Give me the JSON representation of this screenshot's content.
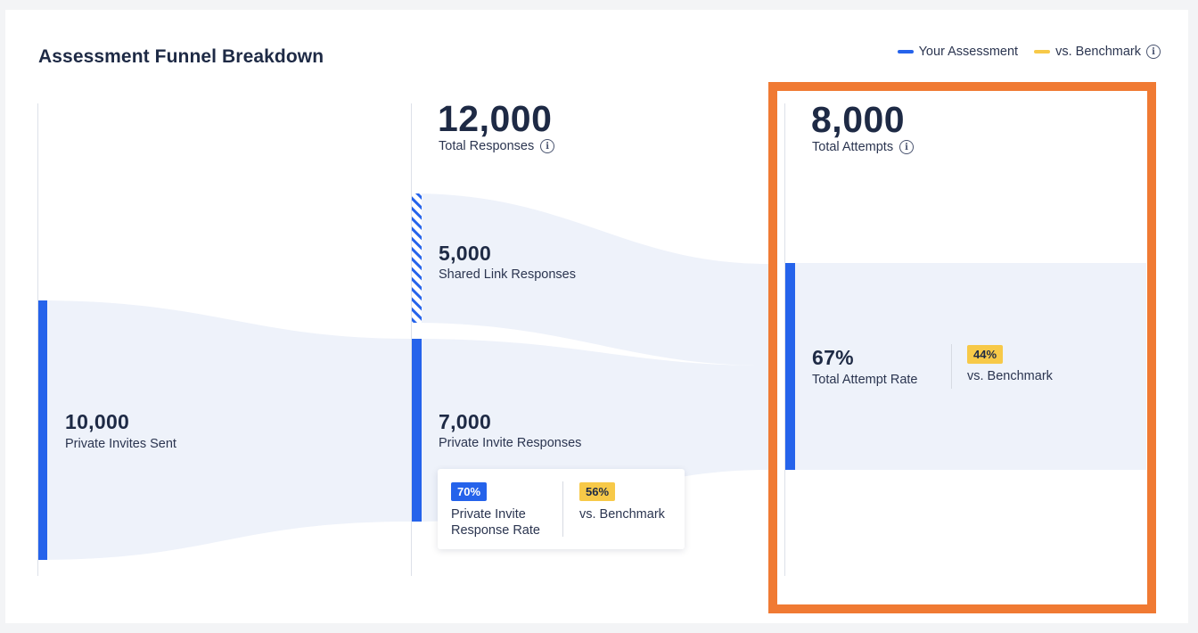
{
  "chart_data": {
    "type": "funnel",
    "title": "Assessment Funnel Breakdown",
    "legend": [
      {
        "name": "Your Assessment",
        "color": "#2563eb"
      },
      {
        "name": "vs. Benchmark",
        "color": "#f7c948"
      }
    ],
    "legend_placement": "top-right",
    "stages": [
      {
        "value": "10,000",
        "label": "Private Invites Sent"
      },
      {
        "value": "12,000",
        "label": "Total Responses",
        "segments": [
          {
            "value": "5,000",
            "label": "Shared Link Responses",
            "pattern": "hatched"
          },
          {
            "value": "7,000",
            "label": "Private Invite Responses",
            "rate": {
              "value": "70%",
              "label": "Private Invite Response Rate",
              "benchmark": "56%",
              "benchmark_label": "vs. Benchmark"
            }
          }
        ]
      },
      {
        "value": "8,000",
        "label": "Total Attempts",
        "rate": {
          "value": "67%",
          "label": "Total Attempt Rate",
          "benchmark": "44%",
          "benchmark_label": "vs. Benchmark"
        },
        "highlighted": true
      }
    ]
  },
  "colors": {
    "accent": "#2563eb",
    "benchmark": "#f7c948",
    "flow": "#eef2fa",
    "highlight": "#f07a33",
    "text": "#1e2a45"
  },
  "icons": {
    "info": "info-icon"
  },
  "info_glyph": "i",
  "tip_label_line1": "Private Invite",
  "tip_label_line2": "Response Rate"
}
